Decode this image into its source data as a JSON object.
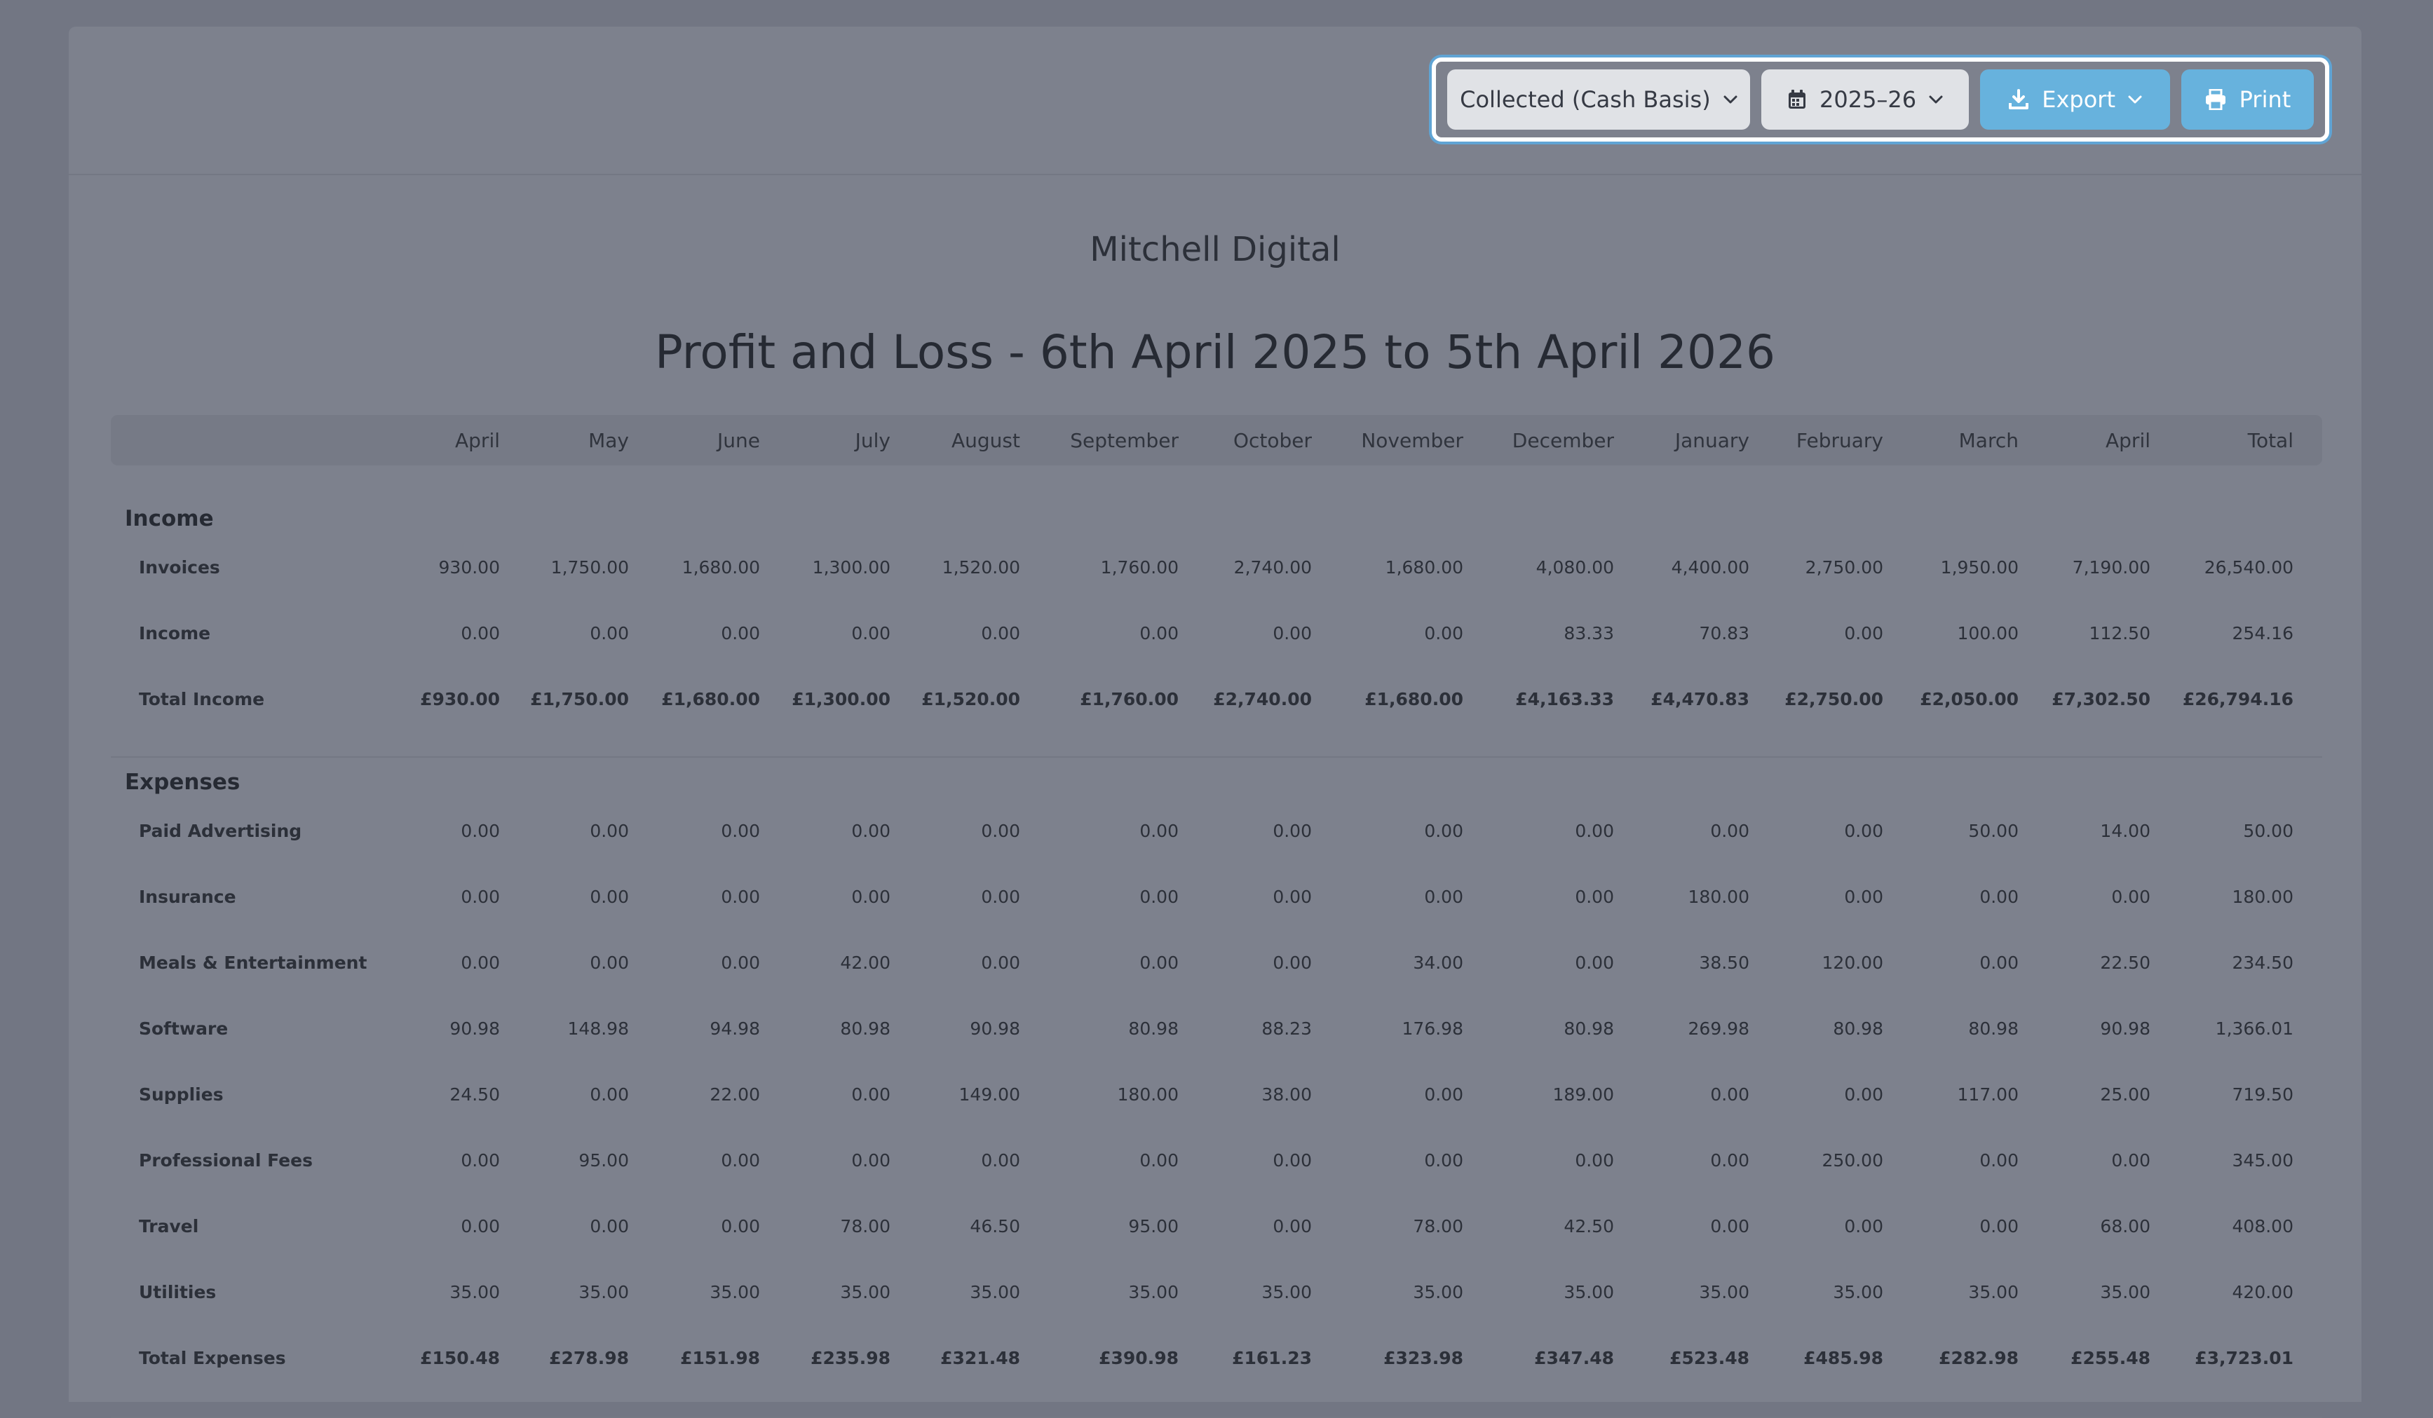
{
  "toolbar": {
    "basis_label": "Collected (Cash Basis)",
    "year_label": "2025–26",
    "export_label": "Export",
    "print_label": "Print"
  },
  "report": {
    "company": "Mitchell Digital",
    "title": "Profit and Loss - 6th April 2025 to 5th April 2026"
  },
  "table": {
    "columns": [
      "April",
      "May",
      "June",
      "July",
      "August",
      "September",
      "October",
      "November",
      "December",
      "January",
      "February",
      "March",
      "April",
      "Total"
    ],
    "income": {
      "heading": "Income",
      "rows": [
        {
          "label": "Invoices",
          "values": [
            "930.00",
            "1,750.00",
            "1,680.00",
            "1,300.00",
            "1,520.00",
            "1,760.00",
            "2,740.00",
            "1,680.00",
            "4,080.00",
            "4,400.00",
            "2,750.00",
            "1,950.00",
            "7,190.00",
            "26,540.00"
          ]
        },
        {
          "label": "Income",
          "values": [
            "0.00",
            "0.00",
            "0.00",
            "0.00",
            "0.00",
            "0.00",
            "0.00",
            "0.00",
            "83.33",
            "70.83",
            "0.00",
            "100.00",
            "112.50",
            "254.16"
          ]
        }
      ],
      "total": {
        "label": "Total Income",
        "values": [
          "£930.00",
          "£1,750.00",
          "£1,680.00",
          "£1,300.00",
          "£1,520.00",
          "£1,760.00",
          "£2,740.00",
          "£1,680.00",
          "£4,163.33",
          "£4,470.83",
          "£2,750.00",
          "£2,050.00",
          "£7,302.50",
          "£26,794.16"
        ]
      }
    },
    "expenses": {
      "heading": "Expenses",
      "rows": [
        {
          "label": "Paid Advertising",
          "values": [
            "0.00",
            "0.00",
            "0.00",
            "0.00",
            "0.00",
            "0.00",
            "0.00",
            "0.00",
            "0.00",
            "0.00",
            "0.00",
            "50.00",
            "14.00",
            "50.00"
          ]
        },
        {
          "label": "Insurance",
          "values": [
            "0.00",
            "0.00",
            "0.00",
            "0.00",
            "0.00",
            "0.00",
            "0.00",
            "0.00",
            "0.00",
            "180.00",
            "0.00",
            "0.00",
            "0.00",
            "180.00"
          ]
        },
        {
          "label": "Meals & Entertainment",
          "values": [
            "0.00",
            "0.00",
            "0.00",
            "42.00",
            "0.00",
            "0.00",
            "0.00",
            "34.00",
            "0.00",
            "38.50",
            "120.00",
            "0.00",
            "22.50",
            "234.50"
          ]
        },
        {
          "label": "Software",
          "values": [
            "90.98",
            "148.98",
            "94.98",
            "80.98",
            "90.98",
            "80.98",
            "88.23",
            "176.98",
            "80.98",
            "269.98",
            "80.98",
            "80.98",
            "90.98",
            "1,366.01"
          ]
        },
        {
          "label": "Supplies",
          "values": [
            "24.50",
            "0.00",
            "22.00",
            "0.00",
            "149.00",
            "180.00",
            "38.00",
            "0.00",
            "189.00",
            "0.00",
            "0.00",
            "117.00",
            "25.00",
            "719.50"
          ]
        },
        {
          "label": "Professional Fees",
          "values": [
            "0.00",
            "95.00",
            "0.00",
            "0.00",
            "0.00",
            "0.00",
            "0.00",
            "0.00",
            "0.00",
            "0.00",
            "250.00",
            "0.00",
            "0.00",
            "345.00"
          ]
        },
        {
          "label": "Travel",
          "values": [
            "0.00",
            "0.00",
            "0.00",
            "78.00",
            "46.50",
            "95.00",
            "0.00",
            "78.00",
            "42.50",
            "0.00",
            "0.00",
            "0.00",
            "68.00",
            "408.00"
          ]
        },
        {
          "label": "Utilities",
          "values": [
            "35.00",
            "35.00",
            "35.00",
            "35.00",
            "35.00",
            "35.00",
            "35.00",
            "35.00",
            "35.00",
            "35.00",
            "35.00",
            "35.00",
            "35.00",
            "420.00"
          ]
        }
      ],
      "total": {
        "label": "Total Expenses",
        "values": [
          "£150.48",
          "£278.98",
          "£151.98",
          "£235.98",
          "£321.48",
          "£390.98",
          "£161.23",
          "£323.98",
          "£347.48",
          "£523.48",
          "£485.98",
          "£282.98",
          "£255.48",
          "£3,723.01"
        ]
      }
    }
  }
}
